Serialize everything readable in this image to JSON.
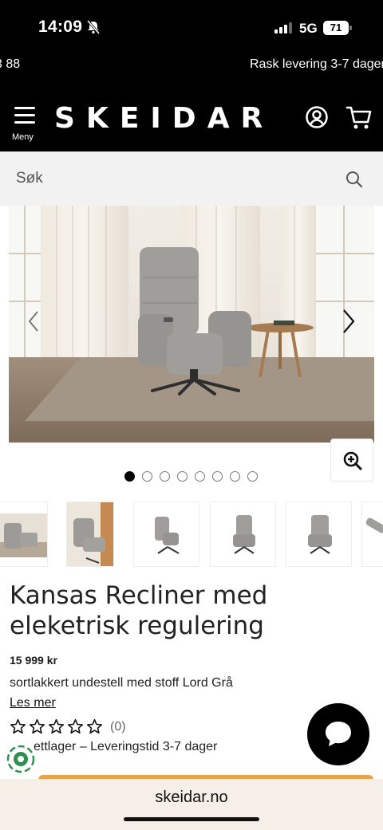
{
  "status": {
    "time": "14:09",
    "network": "5G",
    "battery": "71"
  },
  "ticker": {
    "left_text": "3 88",
    "right_text": "Rask levering 3-7 dager"
  },
  "header": {
    "menu_label": "Meny",
    "logo": "SKEIDAR"
  },
  "search": {
    "placeholder": "Søk"
  },
  "gallery": {
    "slide_count": 8,
    "active_slide": 1
  },
  "product": {
    "title": "Kansas Recliner med eleketrisk regulering",
    "price": "15 999 kr",
    "description": "sortlakkert undestell med stoff Lord Grå",
    "read_more": "Les mer",
    "rating_stars": 0,
    "review_count": "(0)",
    "stock": "ettlager – Leveringstid 3-7 dager"
  },
  "browser": {
    "url": "skeidar.no"
  },
  "colors": {
    "header_bg": "#000000",
    "search_bg": "#f2f2f2",
    "cta_accent": "#e9a14a",
    "url_bar_bg": "#f6efe8"
  }
}
